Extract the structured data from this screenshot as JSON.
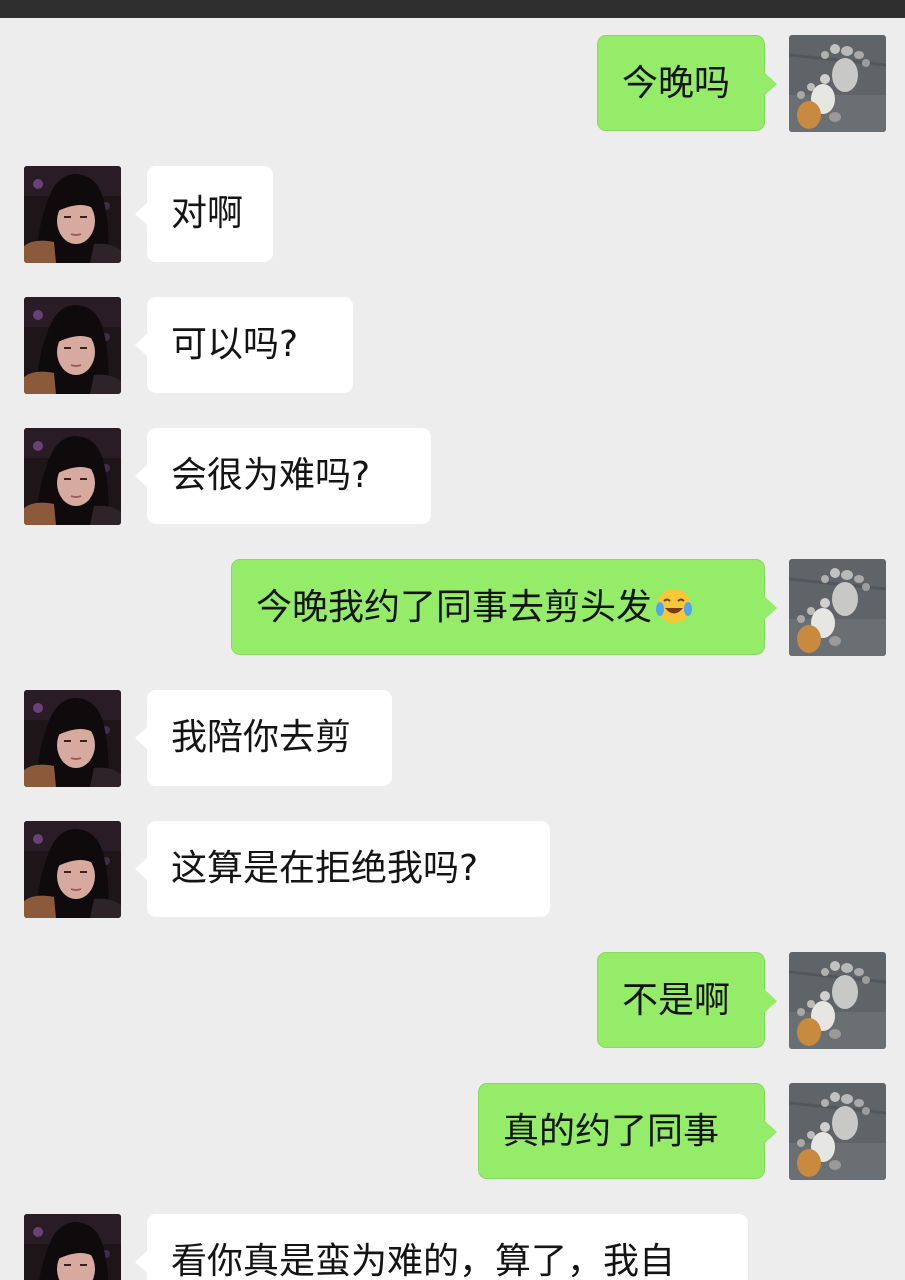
{
  "messages": [
    {
      "side": "out",
      "text": "今晚吗"
    },
    {
      "side": "in",
      "text": "对啊"
    },
    {
      "side": "in",
      "text": "可以吗?"
    },
    {
      "side": "in",
      "text": "会很为难吗?"
    },
    {
      "side": "out",
      "text": "今晚我约了同事去剪头发",
      "emoji": "crying-laughing-emoji"
    },
    {
      "side": "in",
      "text": "我陪你去剪"
    },
    {
      "side": "in",
      "text": "这算是在拒绝我吗?"
    },
    {
      "side": "out",
      "text": "不是啊"
    },
    {
      "side": "out",
      "text": "真的约了同事"
    },
    {
      "side": "in",
      "text": "看你真是蛮为难的，算了，我自"
    }
  ],
  "colors": {
    "chat_background": "#ededed",
    "incoming_bubble": "#ffffff",
    "outgoing_bubble": "#95ec69",
    "status_bar": "#2f2f2f"
  }
}
